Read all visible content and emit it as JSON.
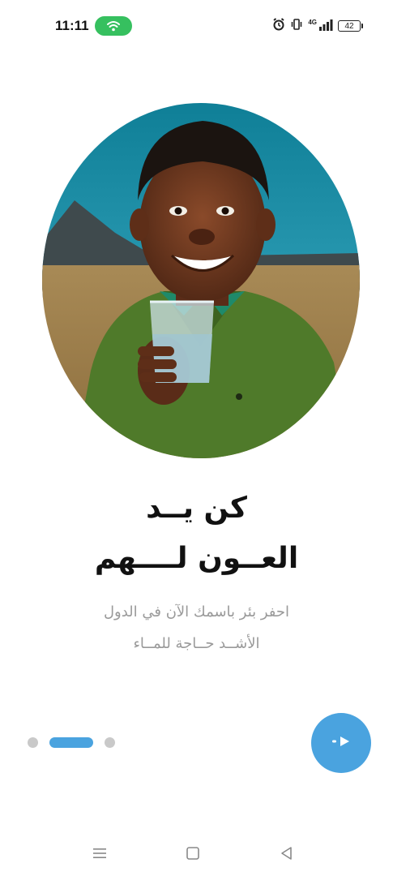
{
  "status_bar": {
    "time": "11:11",
    "network_label": "4G",
    "battery_level": "42",
    "icons": [
      "wifi-hotspot-icon",
      "alarm-icon",
      "vibrate-icon",
      "signal-icon",
      "battery-icon"
    ]
  },
  "hero": {
    "image": "boy-holding-water-glass-photo"
  },
  "onboarding": {
    "title_line_1": "كن يــد",
    "title_line_2": "العــون لــــهم",
    "subtitle_line_1": "احفر بئر باسمك الآن في الدول",
    "subtitle_line_2": "الأشــد حــاجة للمــاء",
    "page_count": 3,
    "active_page": 2
  },
  "next_button": {
    "icon": "arrow-right-icon",
    "color": "#4aa3df"
  },
  "colors": {
    "accent": "#4aa3df",
    "dot_inactive": "#c9c9c9",
    "title": "#111111",
    "subtitle": "#9a9a9a",
    "wifi_pill": "#36c05f"
  },
  "navigation_bar": {
    "icons": [
      "menu-icon",
      "home-square-icon",
      "back-triangle-icon"
    ]
  }
}
